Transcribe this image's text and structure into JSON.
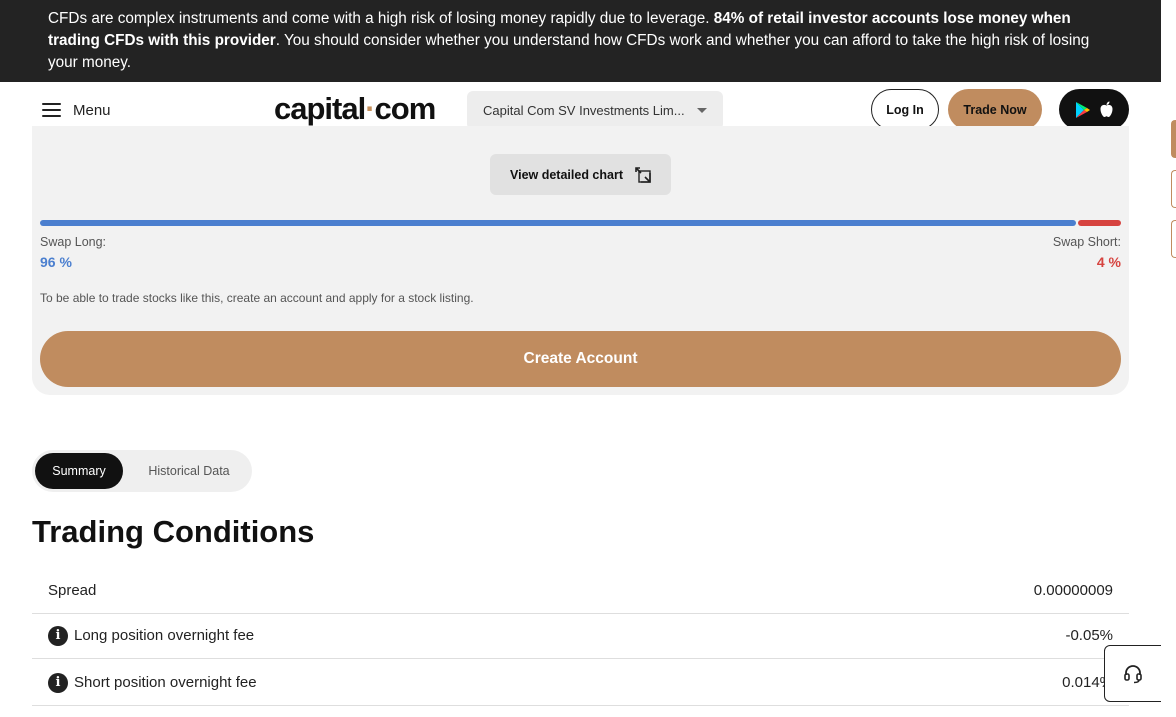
{
  "banner": {
    "text_pre": "CFDs are complex instruments and come with a high risk of losing money rapidly due to leverage. ",
    "text_bold": "84% of retail investor accounts lose money when trading CFDs with this provider",
    "text_post": ". You should consider whether you understand how CFDs work and whether you can afford to take the high risk of losing your money."
  },
  "nav": {
    "menu_label": "Menu",
    "logo_left": "capital",
    "logo_dot": "·",
    "logo_right": "com",
    "entity_select": "Capital Com SV Investments Lim...",
    "login_label": "Log In",
    "trade_label": "Trade Now"
  },
  "card": {
    "view_chart_label": "View detailed chart",
    "swap_long_label": "Swap Long:",
    "swap_long_value": "96 %",
    "swap_long_fraction": 0.96,
    "swap_short_label": "Swap Short:",
    "swap_short_value": "4 %",
    "swap_short_fraction": 0.04,
    "note": "To be able to trade stocks like this, create an account and apply for a stock listing.",
    "create_label": "Create Account"
  },
  "tabs": [
    "Summary",
    "Historical Data"
  ],
  "trading_conditions": {
    "title": "Trading Conditions",
    "rows": [
      {
        "label": "Spread",
        "value": "0.00000009",
        "info": false
      },
      {
        "label": "Long position overnight fee",
        "value": "-0.05%",
        "info": true
      },
      {
        "label": "Short position overnight fee",
        "value": "0.014%",
        "info": true
      }
    ]
  },
  "colors": {
    "accent": "#c08c5f",
    "long": "#4b7fcf",
    "short": "#d6433f",
    "banner_bg": "#232323"
  }
}
